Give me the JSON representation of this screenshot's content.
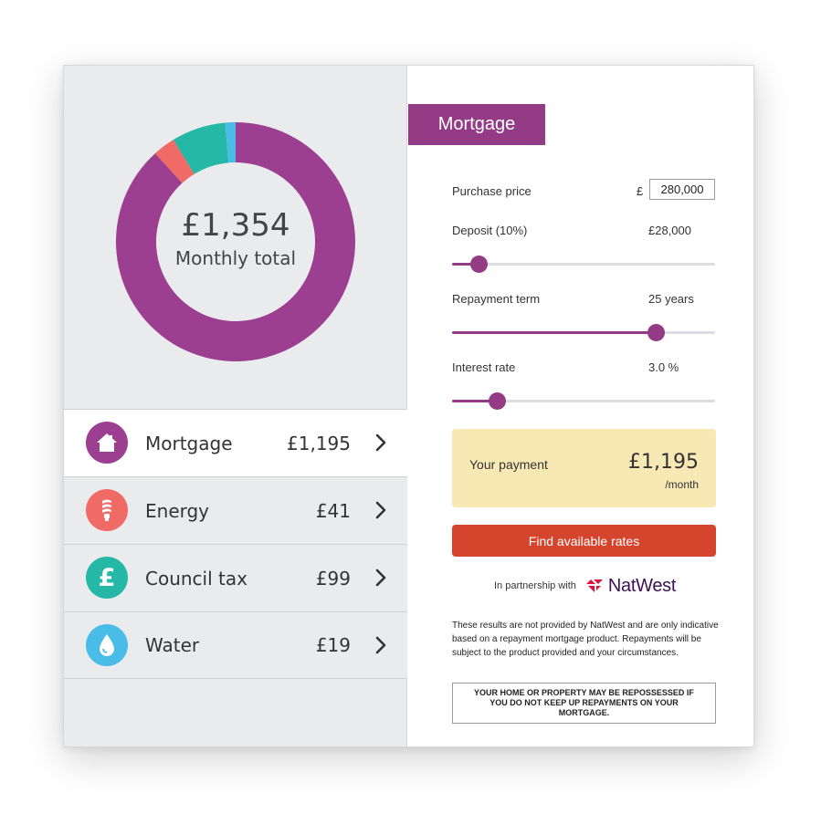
{
  "summary": {
    "total_amount": "£1,354",
    "total_label": "Monthly total"
  },
  "chart_data": {
    "type": "pie",
    "title": "",
    "categories": [
      "Mortgage",
      "Energy",
      "Council tax",
      "Water"
    ],
    "values": [
      1195,
      41,
      99,
      19
    ],
    "colors": [
      "#9c3f90",
      "#f06a66",
      "#25b8a6",
      "#49bde8"
    ]
  },
  "bills": [
    {
      "name": "Mortgage",
      "amount": "£1,195",
      "icon": "house-icon",
      "color": "#9c3f90",
      "active": true
    },
    {
      "name": "Energy",
      "amount": "£41",
      "icon": "lightbulb-icon",
      "color": "#f06a66",
      "active": false
    },
    {
      "name": "Council tax",
      "amount": "£99",
      "icon": "pound-icon",
      "color": "#25b8a6",
      "active": false
    },
    {
      "name": "Water",
      "amount": "£19",
      "icon": "water-drop-icon",
      "color": "#49bde8",
      "active": false
    }
  ],
  "calculator": {
    "tab_label": "Mortgage",
    "purchase_price": {
      "label": "Purchase price",
      "currency": "£",
      "value": "280,000"
    },
    "deposit": {
      "label": "Deposit (10%)",
      "value": "£28,000",
      "slider_fraction": 0.1
    },
    "term": {
      "label": "Repayment term",
      "value": "25 years",
      "slider_fraction": 0.775
    },
    "interest": {
      "label": "Interest rate",
      "value": "3.0 %",
      "slider_fraction": 0.17
    },
    "payment": {
      "label": "Your payment",
      "amount": "£1,195",
      "unit": "/month"
    },
    "find_button": "Find available rates",
    "partner_text": "In partnership with",
    "partner_name": "NatWest",
    "disclaimer": "These results are not provided by NatWest and are only indicative based on a repayment mortgage product. Repayments will be subject to the product provided and your circumstances.",
    "warning": "YOUR HOME OR PROPERTY MAY BE REPOSSESSED IF YOU DO NOT KEEP UP REPAYMENTS ON YOUR MORTGAGE."
  },
  "colors": {
    "accent": "#943b86",
    "button": "#d5452d",
    "payment_bg": "#f8e8b3"
  }
}
